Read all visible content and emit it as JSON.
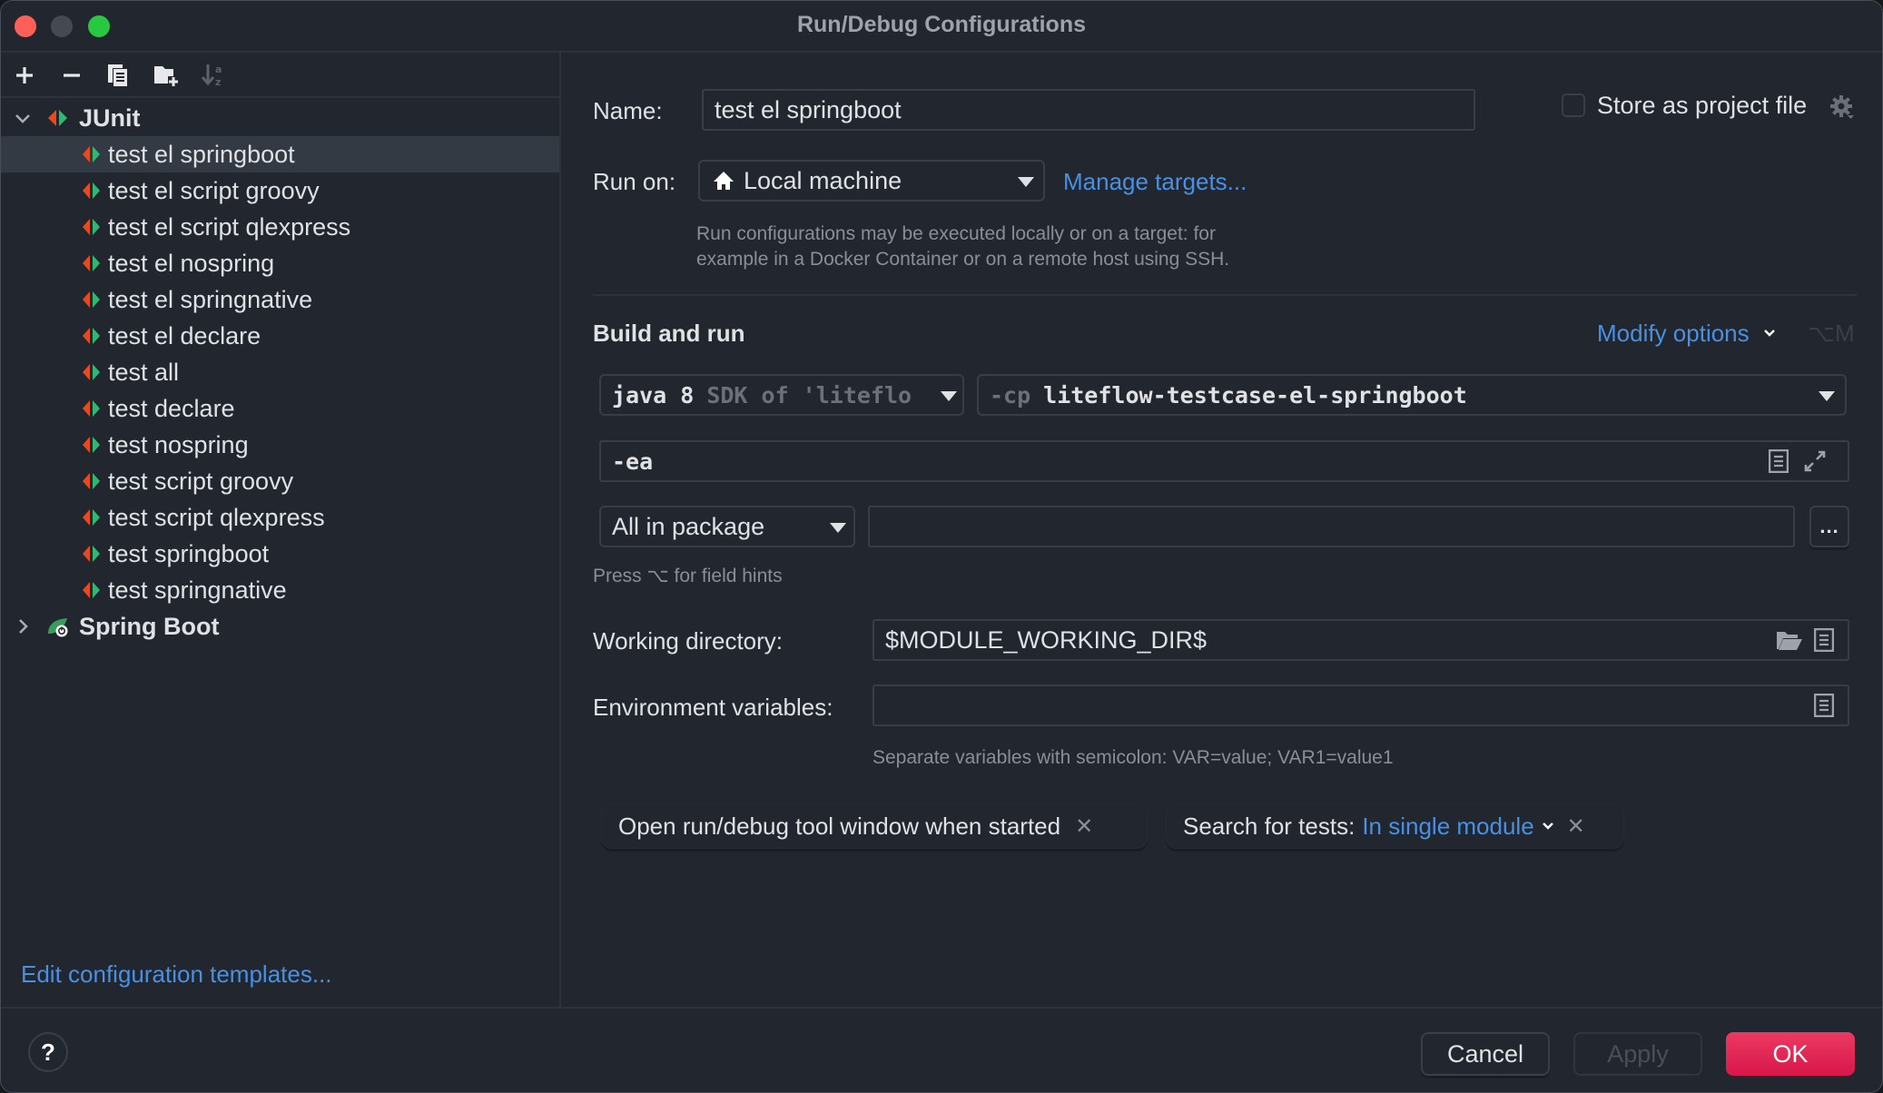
{
  "window": {
    "title": "Run/Debug Configurations"
  },
  "toolbar": {
    "add_icon": "plus-icon",
    "remove_icon": "minus-icon",
    "copy_icon": "copy-icon",
    "new_folder_icon": "folder-plus-icon",
    "sort_icon": "sort-alpha-icon"
  },
  "tree": {
    "groups": [
      {
        "label": "JUnit",
        "expanded": true,
        "icon": "junit-icon",
        "items": [
          {
            "label": "test el springboot",
            "selected": true
          },
          {
            "label": "test el script groovy"
          },
          {
            "label": "test el script qlexpress"
          },
          {
            "label": "test el nospring"
          },
          {
            "label": "test el springnative"
          },
          {
            "label": "test el declare"
          },
          {
            "label": "test all"
          },
          {
            "label": "test declare"
          },
          {
            "label": "test nospring"
          },
          {
            "label": "test script groovy"
          },
          {
            "label": "test script qlexpress"
          },
          {
            "label": "test springboot"
          },
          {
            "label": "test springnative"
          }
        ]
      },
      {
        "label": "Spring Boot",
        "expanded": false,
        "icon": "spring-boot-icon"
      }
    ],
    "edit_templates_link": "Edit configuration templates..."
  },
  "form": {
    "name_label": "Name:",
    "name_value": "test el springboot",
    "store_as_project_file_label": "Store as project file",
    "store_as_project_file_checked": false,
    "run_on_label": "Run on:",
    "run_on_value": "Local machine",
    "manage_targets_link": "Manage targets...",
    "run_on_hint_line1": "Run configurations may be executed locally or on a target: for",
    "run_on_hint_line2": "example in a Docker Container or on a remote host using SSH.",
    "build_and_run_title": "Build and run",
    "modify_options_link": "Modify options",
    "modify_options_shortcut": "⌥M",
    "jdk_value_main": "java 8",
    "jdk_value_dim": "SDK of 'liteflo",
    "cp_prefix": "-cp",
    "cp_value": "liteflow-testcase-el-springboot",
    "vm_options_value": "-ea",
    "test_kind_value": "All in package",
    "package_value": "",
    "browse_button_label": "...",
    "field_hints": "Press ⌥ for field hints",
    "working_dir_label": "Working directory:",
    "working_dir_value": "$MODULE_WORKING_DIR$",
    "env_vars_label": "Environment variables:",
    "env_vars_value": "",
    "env_vars_hint": "Separate variables with semicolon: VAR=value; VAR1=value1",
    "chips": [
      {
        "label": "Open run/debug tool window when started"
      },
      {
        "label": "Search for tests:",
        "value": "In single module"
      }
    ]
  },
  "footer": {
    "help_label": "?",
    "cancel_label": "Cancel",
    "apply_label": "Apply",
    "ok_label": "OK"
  },
  "colors": {
    "accent_link": "#4a90e2",
    "ok_button": "#e0234f",
    "background": "#22272f",
    "selected_row": "#343a43"
  }
}
